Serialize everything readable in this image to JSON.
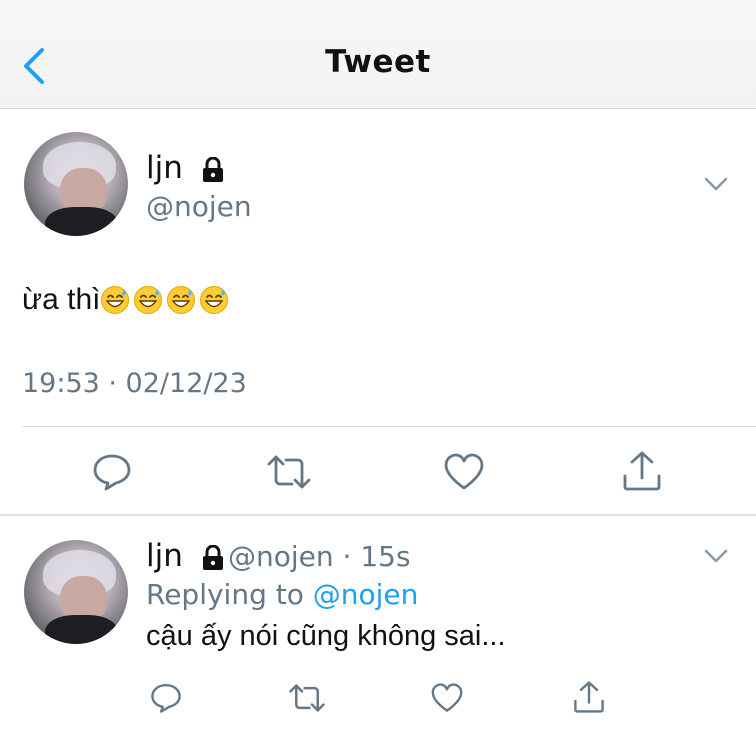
{
  "header": {
    "title": "Tweet",
    "back_icon": "chevron-left-icon",
    "accent": "#1da1f2"
  },
  "tweet": {
    "author_name": "ljn",
    "handle": "@nojen",
    "text": "ừa thì",
    "emojis": [
      "😅",
      "😅",
      "😅",
      "😅"
    ],
    "timestamp": "19:53 · 02/12/23",
    "actions": [
      "reply-icon",
      "retweet-icon",
      "like-icon",
      "share-icon"
    ]
  },
  "reply": {
    "author_name": "ljn",
    "handle": "@nojen",
    "time": "· 15s",
    "replying_label": "Replying to",
    "replying_mention": "@nojen",
    "text": "cậu ấy nói cũng không sai...",
    "actions": [
      "reply-icon",
      "retweet-icon",
      "like-icon",
      "share-icon"
    ]
  }
}
